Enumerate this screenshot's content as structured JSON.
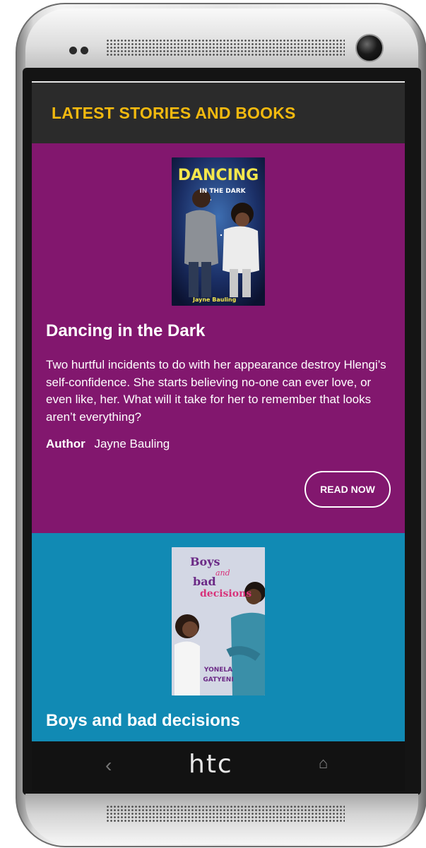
{
  "device": {
    "brand_logo": "htc",
    "back_glyph": "‹",
    "home_glyph": "⌂"
  },
  "header": {
    "title": "LATEST STORIES AND BOOKS"
  },
  "books": [
    {
      "title": "Dancing in the Dark",
      "cover_title_line1": "DANCING",
      "cover_title_line2": "IN THE DARK",
      "cover_author": "Jayne Bauling",
      "description": "Two hurtful incidents to do with her appearance destroy Hlengi’s self-confidence. She starts believing no-one can ever love, or even like, her. What will it take for her to remember that looks aren’t everything?",
      "author_label": "Author",
      "author_name": "Jayne Bauling",
      "button_label": "READ NOW",
      "accent_color": "#82176e"
    },
    {
      "title": "Boys and bad decisions",
      "cover_title_line1": "Boys",
      "cover_title_line2": "and",
      "cover_title_line3": "bad",
      "cover_title_line4": "decisions",
      "cover_author_line1": "YONELA",
      "cover_author_line2": "GATYENI",
      "accent_color": "#118ab4"
    }
  ],
  "colors": {
    "header_bg": "#2b2b2b",
    "header_text": "#f2b90f"
  }
}
